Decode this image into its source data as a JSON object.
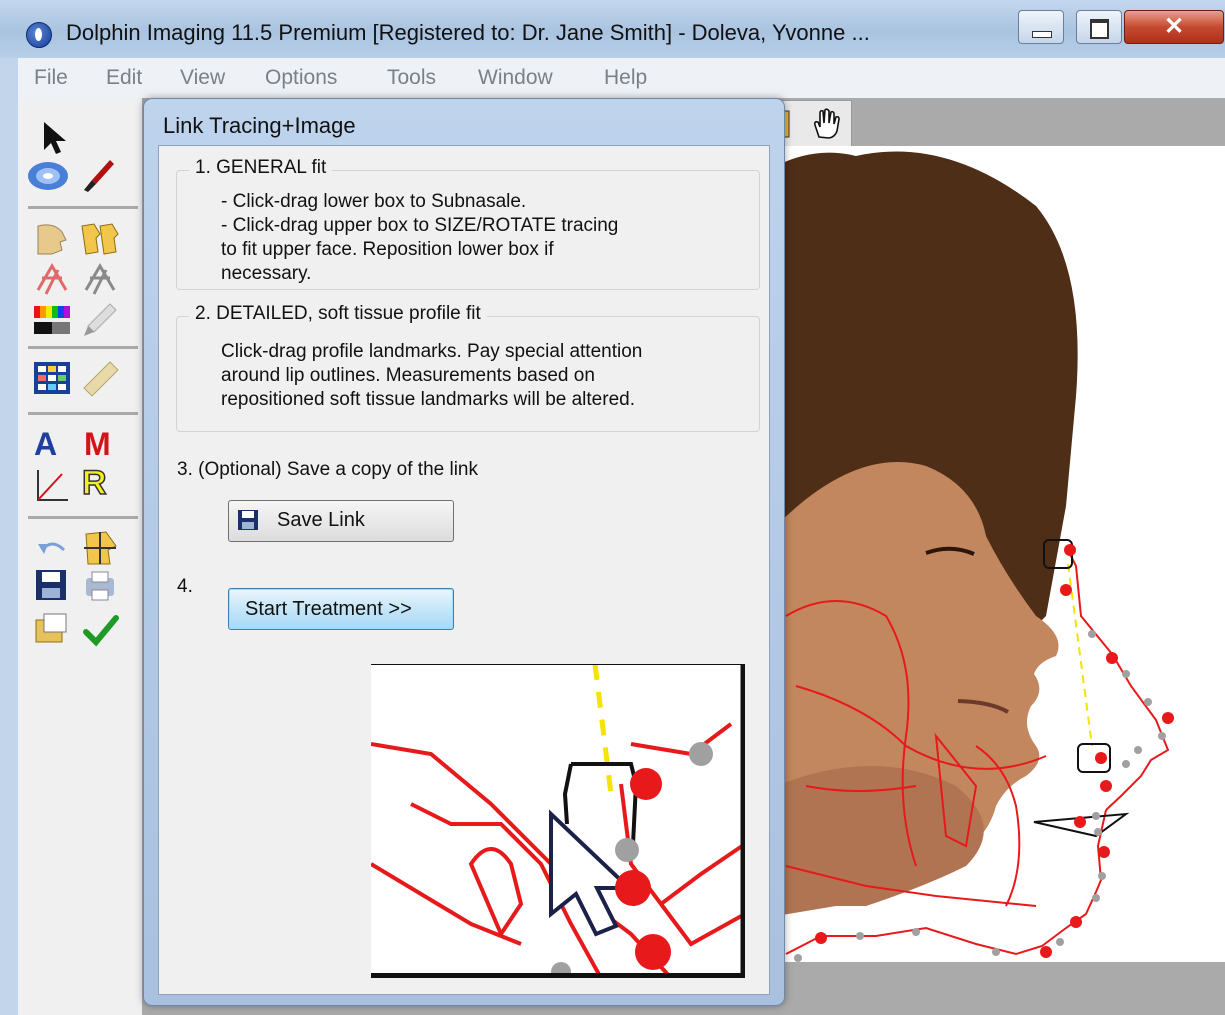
{
  "window": {
    "title": "Dolphin Imaging 11.5 Premium [Registered to: Dr. Jane Smith] - Doleva, Yvonne ...",
    "close_glyph": "✕"
  },
  "menu": [
    "File",
    "Edit",
    "View",
    "Options",
    "Tools",
    "Window",
    "Help"
  ],
  "toolbar_icons": [
    "pointer-arrow-icon",
    "blur-lens-icon",
    "paint-brush-icon",
    "profile-heads-icon",
    "profile-pair-icon",
    "tracing-red-icon",
    "tracing-gray-icon",
    "color-bars-icon",
    "pen-tool-icon",
    "grid-panel-icon",
    "ruler-icon",
    "A",
    "M",
    "angle-icon",
    "R",
    "undo-icon",
    "superimpose-icon",
    "save-disk-icon",
    "print-icon",
    "export-icon",
    "checkmark-icon"
  ],
  "toolbar_letters": {
    "a": "A",
    "m": "M",
    "r": "R"
  },
  "dialog": {
    "title": "Link Tracing+Image",
    "step1": {
      "title": "1. GENERAL fit",
      "line1": "- Click-drag lower box to Subnasale.",
      "line2": "- Click-drag upper box to SIZE/ROTATE tracing",
      "line3": "to fit upper face. Reposition lower box if",
      "line4": "necessary."
    },
    "step2": {
      "title": "2. DETAILED, soft tissue profile fit",
      "line1": "Click-drag profile landmarks. Pay special attention",
      "line2": "around lip outlines. Measurements based on",
      "line3": "repositioned soft tissue landmarks will be altered."
    },
    "step3": "3. (Optional) Save a copy of the link",
    "save_button": "Save Link",
    "step4": "4.",
    "start_button": "Start Treatment >>"
  },
  "colors": {
    "tracing": "#e8191b",
    "landmark_gray": "#a0a0a0",
    "guide_yellow": "#f4e400"
  }
}
